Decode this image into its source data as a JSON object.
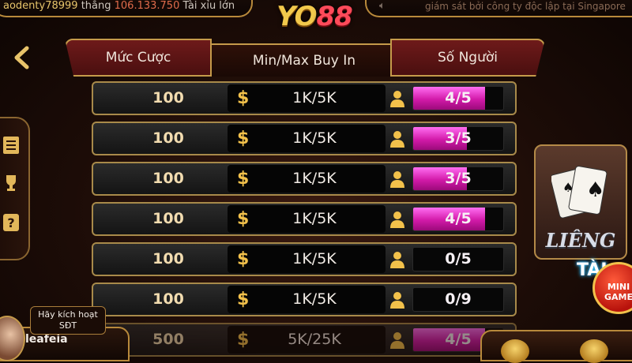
{
  "topbar": {
    "winner_name": "aodenty78999",
    "winner_verb": "thắng",
    "winner_amount": "106.133.750",
    "winner_game": "Tài xỉu lớn",
    "marquee": "giám sát bởi công ty độc lập tại Singapore"
  },
  "logo": {
    "part1": "YO",
    "part2": "88"
  },
  "header": {
    "bet_label": "Mức Cược",
    "buyin_label": "Min/Max Buy In",
    "players_label": "Số Người"
  },
  "rows": [
    {
      "bet": "100",
      "buyin": "1K/5K",
      "occupancy": "4/5",
      "fill": 0.8
    },
    {
      "bet": "100",
      "buyin": "1K/5K",
      "occupancy": "3/5",
      "fill": 0.6
    },
    {
      "bet": "100",
      "buyin": "1K/5K",
      "occupancy": "3/5",
      "fill": 0.6
    },
    {
      "bet": "100",
      "buyin": "1K/5K",
      "occupancy": "4/5",
      "fill": 0.8
    },
    {
      "bet": "100",
      "buyin": "1K/5K",
      "occupancy": "0/5",
      "fill": 0
    },
    {
      "bet": "100",
      "buyin": "1K/5K",
      "occupancy": "0/9",
      "fill": 0
    },
    {
      "bet": "500",
      "buyin": "5K/25K",
      "occupancy": "4/5",
      "fill": 0.8
    }
  ],
  "game_card": {
    "title": "LIÊNG"
  },
  "minigame": {
    "tai": "TÀI",
    "line1": "MINI",
    "line2": "GAME"
  },
  "user": {
    "name": "leafeia",
    "activate_line1": "Hãy kích hoạt",
    "activate_line2": "SĐT"
  },
  "colors": {
    "occupancy_fill": "#d21aa9",
    "accent_gold": "#c59a4a"
  }
}
